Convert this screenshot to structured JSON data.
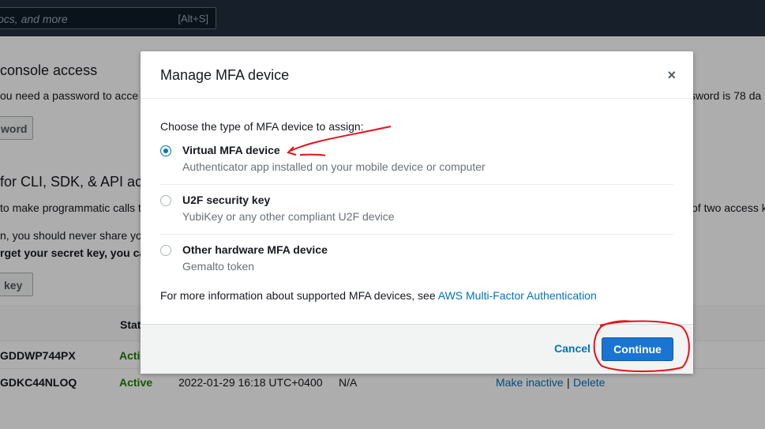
{
  "topbar": {
    "search_placeholder": "ocs, and more",
    "search_shortcut": "[Alt+S]"
  },
  "background": {
    "console_access_title": "console access",
    "console_access_text": "ou need a password to acce",
    "console_access_right": "sword is 78 da",
    "password_button": "word",
    "cli_title": "for CLI, SDK, & API ac",
    "cli_text1": "to make programmatic calls t",
    "cli_text1_right": "of two access ke",
    "cli_text2": "n, you should never share yo",
    "cli_warning": "rget your secret key, you ca",
    "key_button": "key",
    "table_status_header": "Stat",
    "rows": [
      {
        "id": "GDDWP744PX",
        "status": "Acti"
      },
      {
        "id": "GDKC44NLOQ",
        "status": "Active",
        "created": "2022-01-29 16:18 UTC+0400",
        "last_used": "N/A",
        "make_inactive": "Make inactive",
        "divider": "|",
        "delete": "Delete"
      }
    ]
  },
  "modal": {
    "title": "Manage MFA device",
    "close_glyph": "×",
    "prompt": "Choose the type of MFA device to assign:",
    "options": [
      {
        "label": "Virtual MFA device",
        "desc": "Authenticator app installed on your mobile device or computer",
        "selected": true
      },
      {
        "label": "U2F security key",
        "desc": "YubiKey or any other compliant U2F device",
        "selected": false
      },
      {
        "label": "Other hardware MFA device",
        "desc": "Gemalto token",
        "selected": false
      }
    ],
    "info_text": "For more information about supported MFA devices, see ",
    "info_link": "AWS Multi-Factor Authentication",
    "cancel_label": "Cancel",
    "continue_label": "Continue"
  },
  "colors": {
    "accent": "#0073bb",
    "primary_button": "#1a74d1",
    "annotation": "#e8101a"
  }
}
